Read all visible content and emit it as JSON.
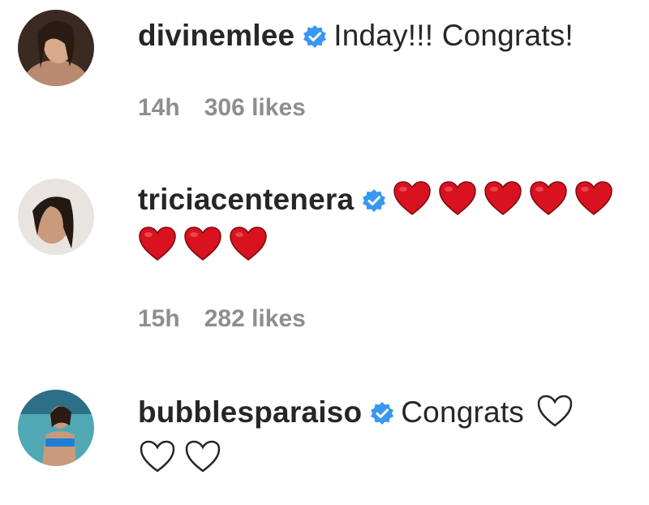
{
  "comments": [
    {
      "username": "divinemlee",
      "verified": true,
      "text": "Inday!!! Congrats!",
      "time": "14h",
      "likes": "306 likes",
      "icon": "verified-badge-icon"
    },
    {
      "username": "triciacentenera",
      "verified": true,
      "text": "",
      "hearts": "8 red hearts",
      "time": "15h",
      "likes": "282 likes",
      "icon": "verified-badge-icon"
    },
    {
      "username": "bubblesparaiso",
      "verified": true,
      "text": "Congrats",
      "hearts": "3 white hearts",
      "icon": "verified-badge-icon"
    }
  ],
  "colors": {
    "verified": "#3897f0",
    "heart_red": "#d8121f",
    "meta": "#8e8e8e"
  }
}
